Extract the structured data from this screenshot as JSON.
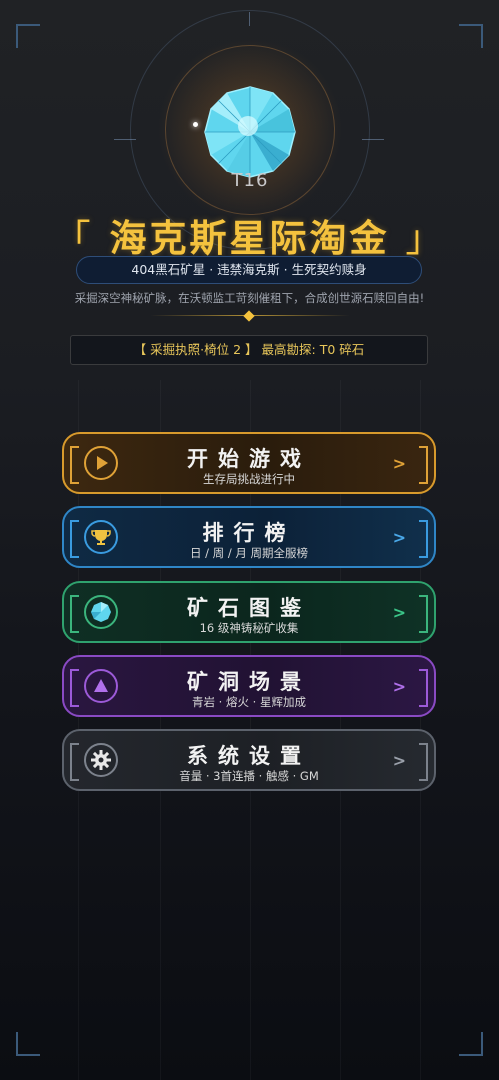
{
  "header": {
    "gem_tier": "T16",
    "title": "海克斯星际淘金",
    "bracket_left": "「",
    "bracket_right": "」",
    "subtitle": "404黑石矿星 · 违禁海克斯 · 生死契约赎身",
    "description": "采掘深空神秘矿脉，在沃顿监工苛刻催租下，合成创世源石赎回自由!",
    "license": "【 采掘执照·椅位 2 】 最高勘探: T0 碎石"
  },
  "menu": [
    {
      "label": "开始游戏",
      "sub": "生存局挑战进行中",
      "icon": "play-icon",
      "color": "#d89a2c"
    },
    {
      "label": "排行榜",
      "sub": "日 / 周 / 月 周期全服榜",
      "icon": "trophy-icon",
      "color": "#2f86c7"
    },
    {
      "label": "矿石图鉴",
      "sub": "16 级神铸秘矿收集",
      "icon": "gem-icon",
      "color": "#2fa26e"
    },
    {
      "label": "矿洞场景",
      "sub": "青岩 · 熔火 · 星辉加成",
      "icon": "mountain-icon",
      "color": "#8a4ac4"
    },
    {
      "label": "系统设置",
      "sub": "音量 · 3首连播 · 触感 · GM",
      "icon": "gear-icon",
      "color": "#5c626c"
    }
  ],
  "chevron": ">",
  "colors": {
    "gold": "#f4c23e",
    "gem": "#5fd6ee"
  }
}
